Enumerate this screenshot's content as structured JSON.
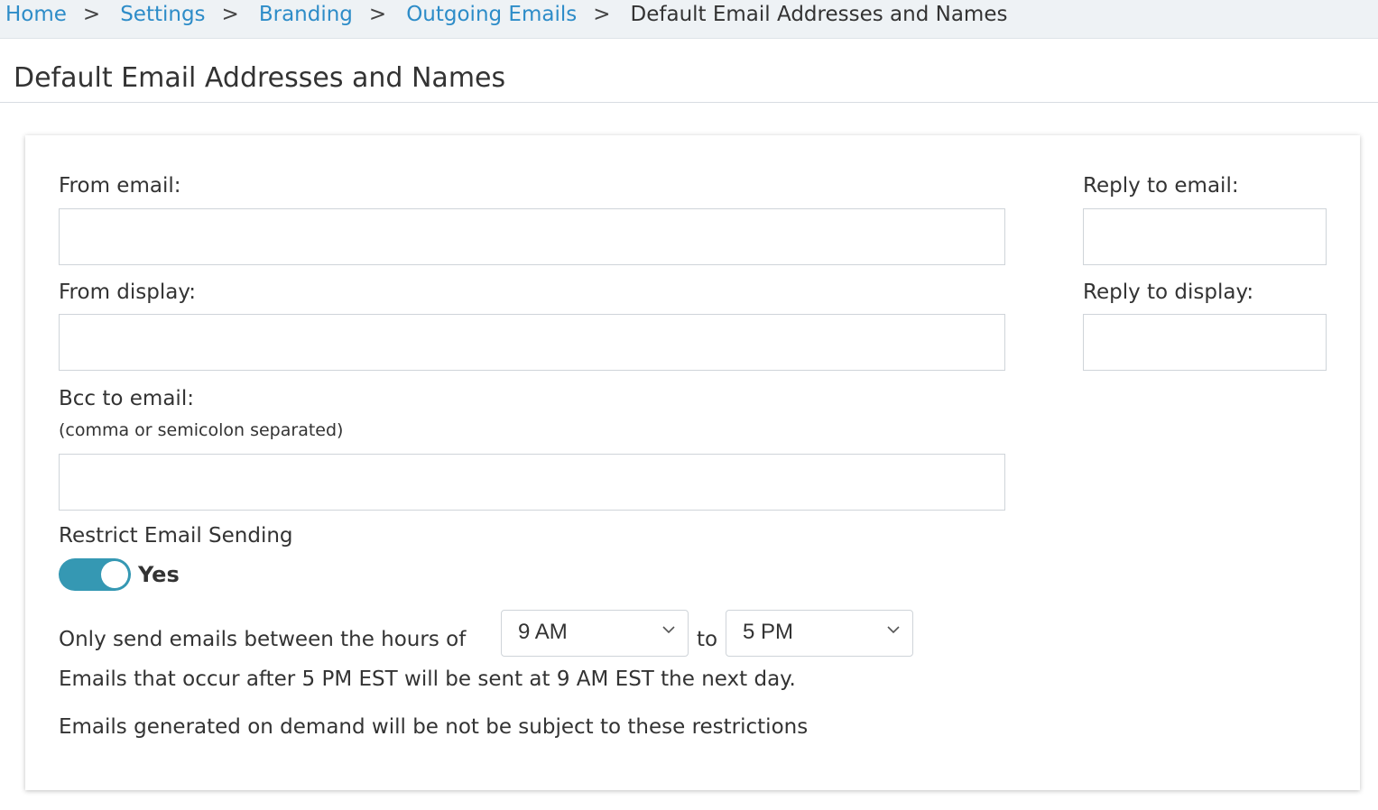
{
  "breadcrumb": {
    "items": [
      "Home",
      "Settings",
      "Branding",
      "Outgoing Emails"
    ],
    "separator": ">",
    "current": "Default Email Addresses and Names"
  },
  "page": {
    "title": "Default Email Addresses and Names"
  },
  "form": {
    "from_email": {
      "label": "From email:",
      "value": ""
    },
    "from_display": {
      "label": "From display:",
      "value": ""
    },
    "reply_to_email": {
      "label": "Reply to email:",
      "value": ""
    },
    "reply_to_display": {
      "label": "Reply to display:",
      "value": ""
    },
    "bcc_email": {
      "label": "Bcc to email:",
      "hint": "(comma or semicolon separated)",
      "value": ""
    },
    "restrict": {
      "label": "Restrict Email Sending",
      "toggle_state": "Yes",
      "enabled": true,
      "hours_prefix": "Only send emails between the hours of",
      "start_hour": "9 AM",
      "to_label": "to",
      "end_hour": "5 PM",
      "note_after_hours": "Emails that occur after 5 PM EST will be sent at 9 AM EST the next day.",
      "note_on_demand": "Emails generated on demand will be not be subject to these restrictions"
    }
  },
  "colors": {
    "link": "#2d8cc8",
    "toggle_on": "#3598b3",
    "breadcrumb_bg": "#eef2f5"
  }
}
